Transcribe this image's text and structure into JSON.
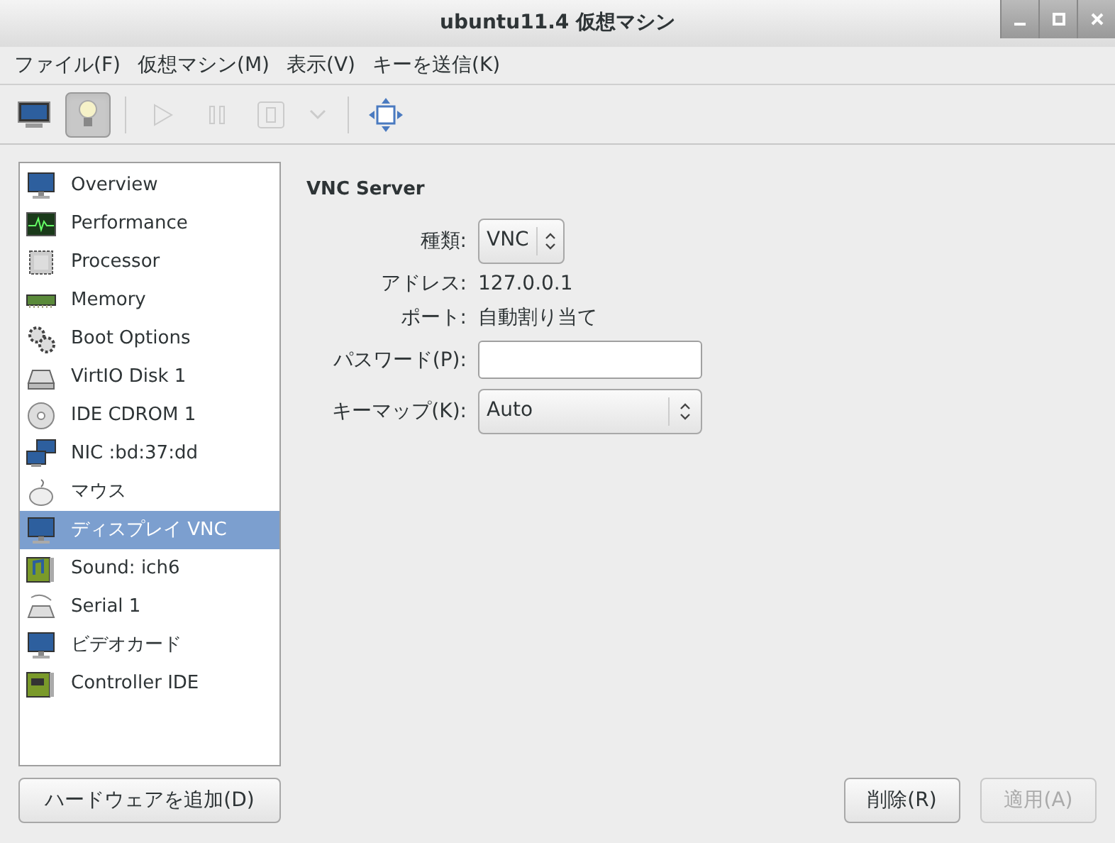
{
  "window": {
    "title": "ubuntu11.4 仮想マシン",
    "controls": [
      {
        "kind": "minimize"
      },
      {
        "kind": "maximize"
      },
      {
        "kind": "close"
      }
    ]
  },
  "menu": [
    "ファイル(F)",
    "仮想マシン(M)",
    "表示(V)",
    "キーを送信(K)"
  ],
  "toolbar": [
    {
      "kind": "monitor",
      "selected": false,
      "disabled": false
    },
    {
      "kind": "bulb",
      "selected": true,
      "disabled": false
    },
    {
      "kind": "sep"
    },
    {
      "kind": "play",
      "selected": false,
      "disabled": true
    },
    {
      "kind": "pause",
      "selected": false,
      "disabled": true
    },
    {
      "kind": "stop",
      "selected": false,
      "disabled": true
    },
    {
      "kind": "caret",
      "selected": false,
      "disabled": true
    },
    {
      "kind": "sep"
    },
    {
      "kind": "fullscreen",
      "selected": false,
      "disabled": false
    }
  ],
  "sidebar": {
    "items": [
      {
        "label": "Overview",
        "kind": "monitor",
        "selected": false
      },
      {
        "label": "Performance",
        "kind": "chart",
        "selected": false
      },
      {
        "label": "Processor",
        "kind": "chip",
        "selected": false
      },
      {
        "label": "Memory",
        "kind": "memory",
        "selected": false
      },
      {
        "label": "Boot Options",
        "kind": "gears",
        "selected": false
      },
      {
        "label": "VirtIO Disk 1",
        "kind": "disk",
        "selected": false
      },
      {
        "label": "IDE CDROM 1",
        "kind": "cdrom",
        "selected": false
      },
      {
        "label": "NIC :bd:37:dd",
        "kind": "network",
        "selected": false
      },
      {
        "label": "マウス",
        "kind": "mouse",
        "selected": false
      },
      {
        "label": "ディスプレイ VNC",
        "kind": "monitor",
        "selected": true
      },
      {
        "label": "Sound: ich6",
        "kind": "sound",
        "selected": false
      },
      {
        "label": "Serial 1",
        "kind": "serial",
        "selected": false
      },
      {
        "label": "ビデオカード",
        "kind": "monitor",
        "selected": false
      },
      {
        "label": "Controller IDE",
        "kind": "card",
        "selected": false
      }
    ],
    "add_button": "ハードウェアを追加(D)"
  },
  "section": {
    "title": "VNC Server",
    "fields": [
      {
        "label": "種類:",
        "kind": "select",
        "value": "VNC"
      },
      {
        "label": "アドレス:",
        "kind": "text",
        "value": "127.0.0.1"
      },
      {
        "label": "ポート:",
        "kind": "text",
        "value": "自動割り当て"
      },
      {
        "label": "パスワード(P):",
        "kind": "input"
      },
      {
        "label": "キーマップ(K):",
        "kind": "select_wide",
        "value": "Auto"
      }
    ]
  },
  "buttons": [
    {
      "label": "削除(R)",
      "disabled": false
    },
    {
      "label": "適用(A)",
      "disabled": true
    }
  ]
}
